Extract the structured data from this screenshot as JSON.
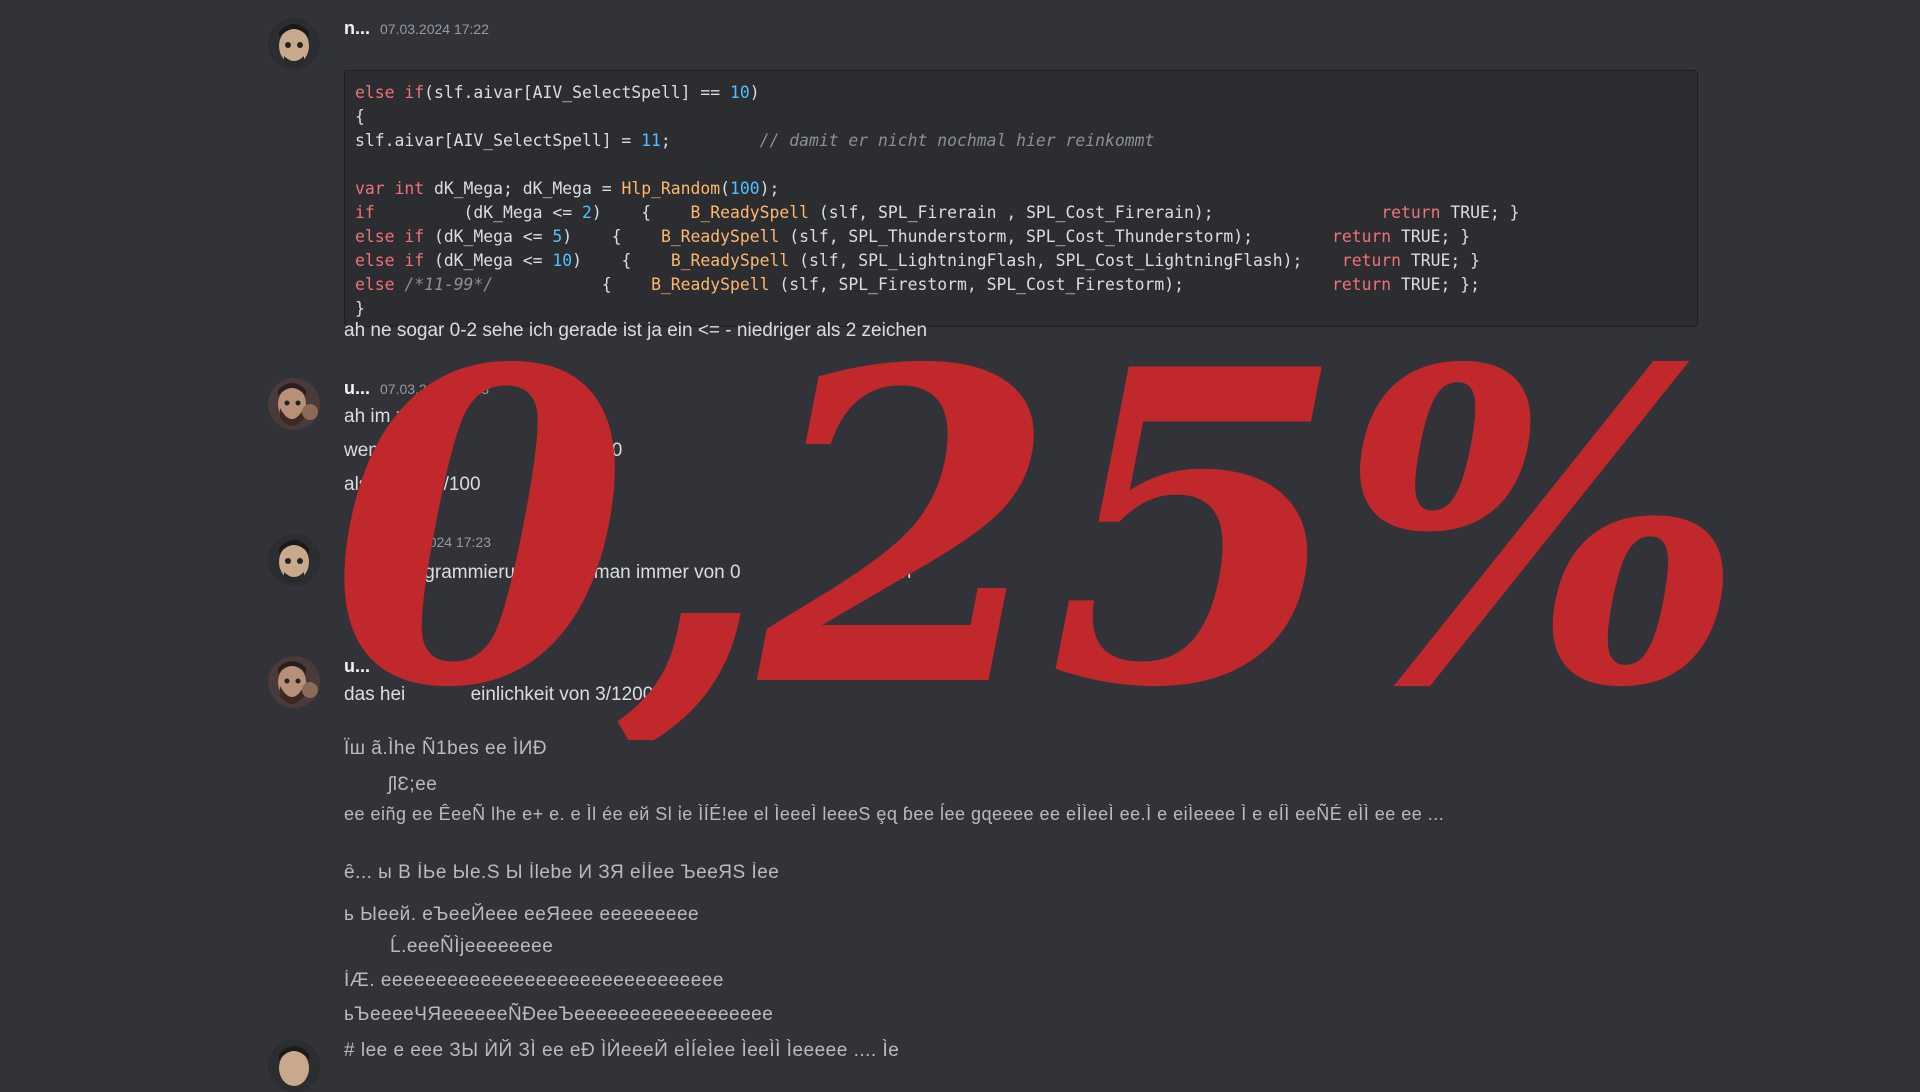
{
  "messages": [
    {
      "username": "n...",
      "timestamp": "07.03.2024 17:22",
      "code": [
        [
          [
            "kw",
            "else if"
          ],
          [
            "",
            "(slf.aivar[AIV_SelectSpell] == "
          ],
          [
            "nm",
            "10"
          ],
          [
            "",
            ")"
          ]
        ],
        [
          [
            "",
            "{"
          ]
        ],
        [
          [
            "",
            "slf.aivar[AIV_SelectSpell] = "
          ],
          [
            "nm",
            "11"
          ],
          [
            "",
            ";         "
          ],
          [
            "cm",
            "// damit er nicht nochmal hier reinkommt"
          ]
        ],
        [
          [
            "",
            ""
          ]
        ],
        [
          [
            "kw",
            "var int"
          ],
          [
            "",
            " dK_Mega; dK_Mega = "
          ],
          [
            "fn",
            "Hlp_Random"
          ],
          [
            "",
            "("
          ],
          [
            "nm",
            "100"
          ],
          [
            "",
            ");"
          ]
        ],
        [
          [
            "kw",
            "if"
          ],
          [
            "",
            "         (dK_Mega <= "
          ],
          [
            "nm",
            "2"
          ],
          [
            "",
            ")    {    "
          ],
          [
            "fn",
            "B_ReadySpell"
          ],
          [
            "",
            " (slf, SPL_Firerain , SPL_Cost_Firerain);                 "
          ],
          [
            "kw",
            "return"
          ],
          [
            "",
            " TRUE; }"
          ]
        ],
        [
          [
            "kw",
            "else if"
          ],
          [
            "",
            " (dK_Mega <= "
          ],
          [
            "nm",
            "5"
          ],
          [
            "",
            ")    {    "
          ],
          [
            "fn",
            "B_ReadySpell"
          ],
          [
            "",
            " (slf, SPL_Thunderstorm, SPL_Cost_Thunderstorm);        "
          ],
          [
            "kw",
            "return"
          ],
          [
            "",
            " TRUE; }"
          ]
        ],
        [
          [
            "kw",
            "else if"
          ],
          [
            "",
            " (dK_Mega <= "
          ],
          [
            "nm",
            "10"
          ],
          [
            "",
            ")    {    "
          ],
          [
            "fn",
            "B_ReadySpell"
          ],
          [
            "",
            " (slf, SPL_LightningFlash, SPL_Cost_LightningFlash);    "
          ],
          [
            "kw",
            "return"
          ],
          [
            "",
            " TRUE; }"
          ]
        ],
        [
          [
            "kw",
            "else"
          ],
          [
            "cm",
            " /*11-99*/"
          ],
          [
            "",
            "           {    "
          ],
          [
            "fn",
            "B_ReadySpell"
          ],
          [
            "",
            " (slf, SPL_Firestorm, SPL_Cost_Firestorm);               "
          ],
          [
            "kw",
            "return"
          ],
          [
            "",
            " TRUE; };"
          ]
        ],
        [
          [
            "",
            "}"
          ]
        ]
      ],
      "text": "ah ne sogar 0-2 sehe ich gerade ist ja ein <= - niedriger als 2 zeichen"
    },
    {
      "username": "u...",
      "timestamp": "07.03.2024 17:23",
      "lines": [
        "ah im zweit",
        "wenn 0",
        "100",
        "als",
        "/100"
      ]
    },
    {
      "timestamp": "07.03.2024 17:23",
      "text_a": "der Programmierung",
      "text_b": "hnet man immer von 0",
      "text_c": "tellen"
    },
    {
      "username": "u...",
      "text_a": "das hei",
      "text_b": "einlichkeit von 3/1200"
    }
  ],
  "garbled": [
    "Ïш ã.Ìhe Ñ1bes ee ÌИÐ",
    "ʃlƐ;ee",
    "ee eiñg ee ÊeeÑ lhe e+     e. e Ìl ée   ей Ѕl   ἰе   ÌÍÉ!ee el ÌeeeÌ lеeeЅ ȩɋ ɓee ĺee gɋееее еe eÌÌeeÌ ee.Ì e eiÌeeeе Ì e eÍÌ eeÑÉ eÌÌ ee ee ...",
    "ȇ...    ы В ÌЬe Ыe.Ѕ Ы Ìlebe И ЗЯ eÌÌee ЪeеЯЅ Ìeе",
    "ь Ыeeй. eЪeeЙeee eeЯeee eeeeeeeee",
    "Ĺ.eeeÑÌjeeeeeeee",
    "ÍÆ. eeeeeeeeеeeeeeeeeeeeeeeeeeeeeee",
    "ьЪeeeeЧЯeeeeeeÑÐeeЪeeeeeeeeeeeeeeeeee",
    "#    lee e eee ЗЫ ЍЙ ЗÌ ee  eÐ ÌЍeeeЙ   eÌÍeÌee ÌeeÌÌ Ìeeeee .... Ìe"
  ],
  "overlay": {
    "text": "0,25%",
    "color": "#c0282c"
  }
}
